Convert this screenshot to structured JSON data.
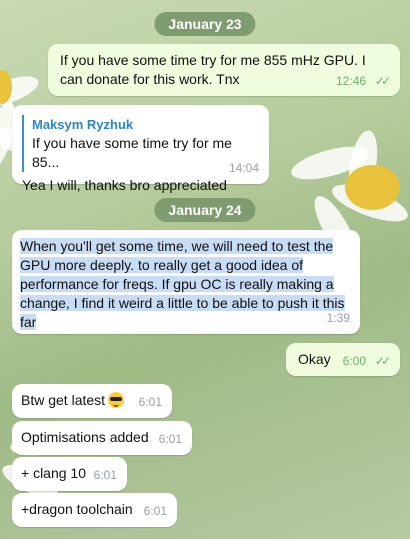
{
  "dates": [
    "January 23",
    "January 24"
  ],
  "messages": [
    {
      "text": "If you have some time try for me 855 mHz GPU. I can donate for this work. Tnx",
      "time": "12:46"
    },
    {
      "reply_name": "Maksym Ryzhuk",
      "reply_text": "If you have some time try for me 85...",
      "text": "Yea I will, thanks bro appreciated",
      "time": "14:04"
    },
    {
      "text": "When you'll get some time, we will need to test the GPU more deeply. to really get a good idea of performance for freqs. If gpu OC is really making a change, I find it weird a little to be able to push it this far",
      "time": "1:39"
    },
    {
      "text": "Okay",
      "time": "6:00"
    },
    {
      "text": "Btw get latest",
      "emoji": "sunglasses-emoji",
      "time": "6:01"
    },
    {
      "text": "Optimisations added",
      "time": "6:01"
    },
    {
      "text": "+ clang 10",
      "time": "6:01"
    },
    {
      "text": "+dragon toolchain",
      "time": "6:01"
    }
  ],
  "colors": {
    "incoming": "#ffffff",
    "outgoing": "#effdde",
    "date_pill": "#7f9c71",
    "reply_accent": "#3a8fd0",
    "selection": "#c8ddf5"
  }
}
